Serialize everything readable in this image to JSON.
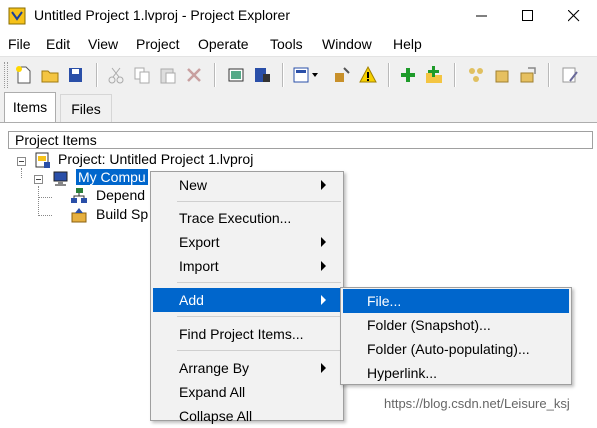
{
  "window": {
    "title": "Untitled Project 1.lvproj - Project Explorer"
  },
  "menubar": {
    "items": [
      "File",
      "Edit",
      "View",
      "Project",
      "Operate",
      "Tools",
      "Window",
      "Help"
    ]
  },
  "toolbar": {
    "buttons": [
      "new-icon",
      "open-icon",
      "save-all-icon",
      "cut-icon",
      "copy-icon",
      "paste-icon",
      "delete-icon",
      "build-icon",
      "deploy-icon",
      "view-dropdown-icon",
      "properties-icon",
      "warning-icon",
      "add-icon",
      "add-folder-icon",
      "arrange-icon",
      "package-icon",
      "export-icon",
      "edit-icon"
    ]
  },
  "tabs": [
    {
      "label": "Items",
      "active": true
    },
    {
      "label": "Files",
      "active": false
    }
  ],
  "tree": {
    "header": "Project Items",
    "rows": [
      {
        "label": "Project: Untitled Project 1.lvproj",
        "icon": "project-icon"
      },
      {
        "label": "My Compu",
        "icon": "computer-icon",
        "selected": true
      },
      {
        "label": "Depend",
        "icon": "dependencies-icon"
      },
      {
        "label": "Build Sp",
        "icon": "build-specs-icon"
      }
    ]
  },
  "context_menu": {
    "items": [
      {
        "label": "New",
        "submenu": true
      },
      {
        "label": "Trace Execution...",
        "submenu": false
      },
      {
        "label": "Export",
        "submenu": true
      },
      {
        "label": "Import",
        "submenu": true
      },
      {
        "label": "Add",
        "submenu": true,
        "highlighted": true
      },
      {
        "label": "Find Project Items...",
        "submenu": false
      },
      {
        "label": "Arrange By",
        "submenu": true
      },
      {
        "label": "Expand All",
        "submenu": false
      },
      {
        "label": "Collapse All",
        "submenu": false
      }
    ]
  },
  "add_submenu": {
    "items": [
      {
        "label": "File...",
        "highlighted": true
      },
      {
        "label": "Folder (Snapshot)..."
      },
      {
        "label": "Folder (Auto-populating)..."
      },
      {
        "label": "Hyperlink..."
      }
    ]
  },
  "watermark": "https://blog.csdn.net/Leisure_ksj",
  "colors": {
    "selection": "#0066cc",
    "toolbar_bg": "#f0f0f0",
    "menu_bg": "#f2f2f2"
  }
}
